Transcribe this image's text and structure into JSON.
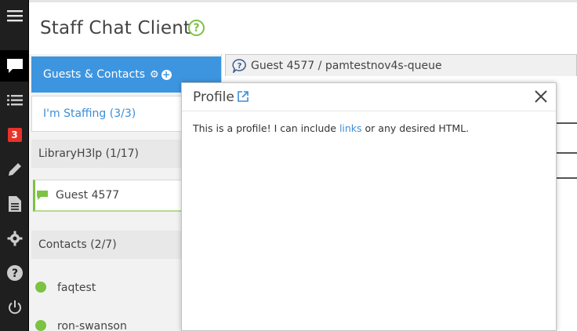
{
  "app": {
    "title": "Staff Chat Client",
    "help_glyph": "?"
  },
  "rail": {
    "icons": [
      "menu-icon",
      "chat-icon",
      "list-icon",
      "badge-icon",
      "pencil-icon",
      "document-icon",
      "gear-icon",
      "help-icon",
      "power-icon"
    ],
    "badge_count": "3",
    "badge_color": "#e8322a"
  },
  "left_panel": {
    "guests_tab_label": "Guests & Contacts",
    "staffing_tab_label": "I'm Staffing (3/3)",
    "queue_section": "LibraryH3lp (1/17)",
    "guest_label": "Guest 4577",
    "contacts_section": "Contacts (2/7)",
    "contacts": [
      {
        "name": "faqtest",
        "status_color": "#7cc243"
      },
      {
        "name": "ron-swanson",
        "status_color": "#7cc243"
      }
    ]
  },
  "chat": {
    "tab_label": "Guest 4577 / pamtestnov4s-queue"
  },
  "profile_modal": {
    "title": "Profile",
    "body_before": "This is a profile!  I can include ",
    "body_link": "links",
    "body_after": " or any desired HTML."
  },
  "colors": {
    "accent_blue": "#3d95e0",
    "link_blue": "#3d8ed6",
    "status_green": "#7cc243",
    "rail_dark": "#1f1f1f"
  }
}
